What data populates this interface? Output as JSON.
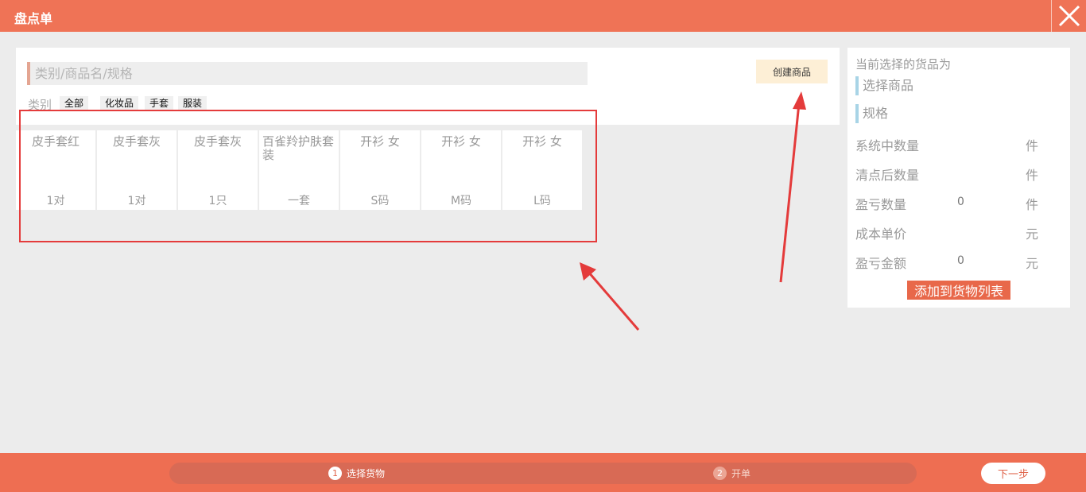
{
  "window": {
    "title": "盘点单",
    "close_icon": "close-icon"
  },
  "search": {
    "placeholder": "类别/商品名/规格",
    "create_label": "创建商品"
  },
  "categories": {
    "label": "类别",
    "items": [
      "全部",
      "化妆品",
      "手套",
      "服装"
    ]
  },
  "products": [
    {
      "name": "皮手套红",
      "spec": "1对"
    },
    {
      "name": "皮手套灰",
      "spec": "1对"
    },
    {
      "name": "皮手套灰",
      "spec": "1只"
    },
    {
      "name": "百雀羚护肤套装",
      "spec": "一套"
    },
    {
      "name": "开衫 女",
      "spec": "S码"
    },
    {
      "name": "开衫 女",
      "spec": "M码"
    },
    {
      "name": "开衫 女",
      "spec": "L码"
    }
  ],
  "detail": {
    "heading": "当前选择的货品为",
    "select_product": "选择商品",
    "spec": "规格",
    "rows": [
      {
        "label": "系统中数量",
        "value": "",
        "unit": "件"
      },
      {
        "label": "清点后数量",
        "value": "",
        "unit": "件"
      },
      {
        "label": "盈亏数量",
        "value": "0",
        "unit": "件"
      },
      {
        "label": "成本单价",
        "value": "",
        "unit": "元"
      },
      {
        "label": "盈亏金额",
        "value": "0",
        "unit": "元"
      }
    ],
    "add_label": "添加到货物列表"
  },
  "steps": [
    {
      "num": "1",
      "label": "选择货物",
      "active": true
    },
    {
      "num": "2",
      "label": "开单",
      "active": false
    }
  ],
  "next_label": "下一步",
  "colors": {
    "brand": "#ef7356",
    "annotation": "#e43b3b",
    "accent_bar": "#a8d4e6",
    "create_btn_bg": "#fdefd6"
  }
}
